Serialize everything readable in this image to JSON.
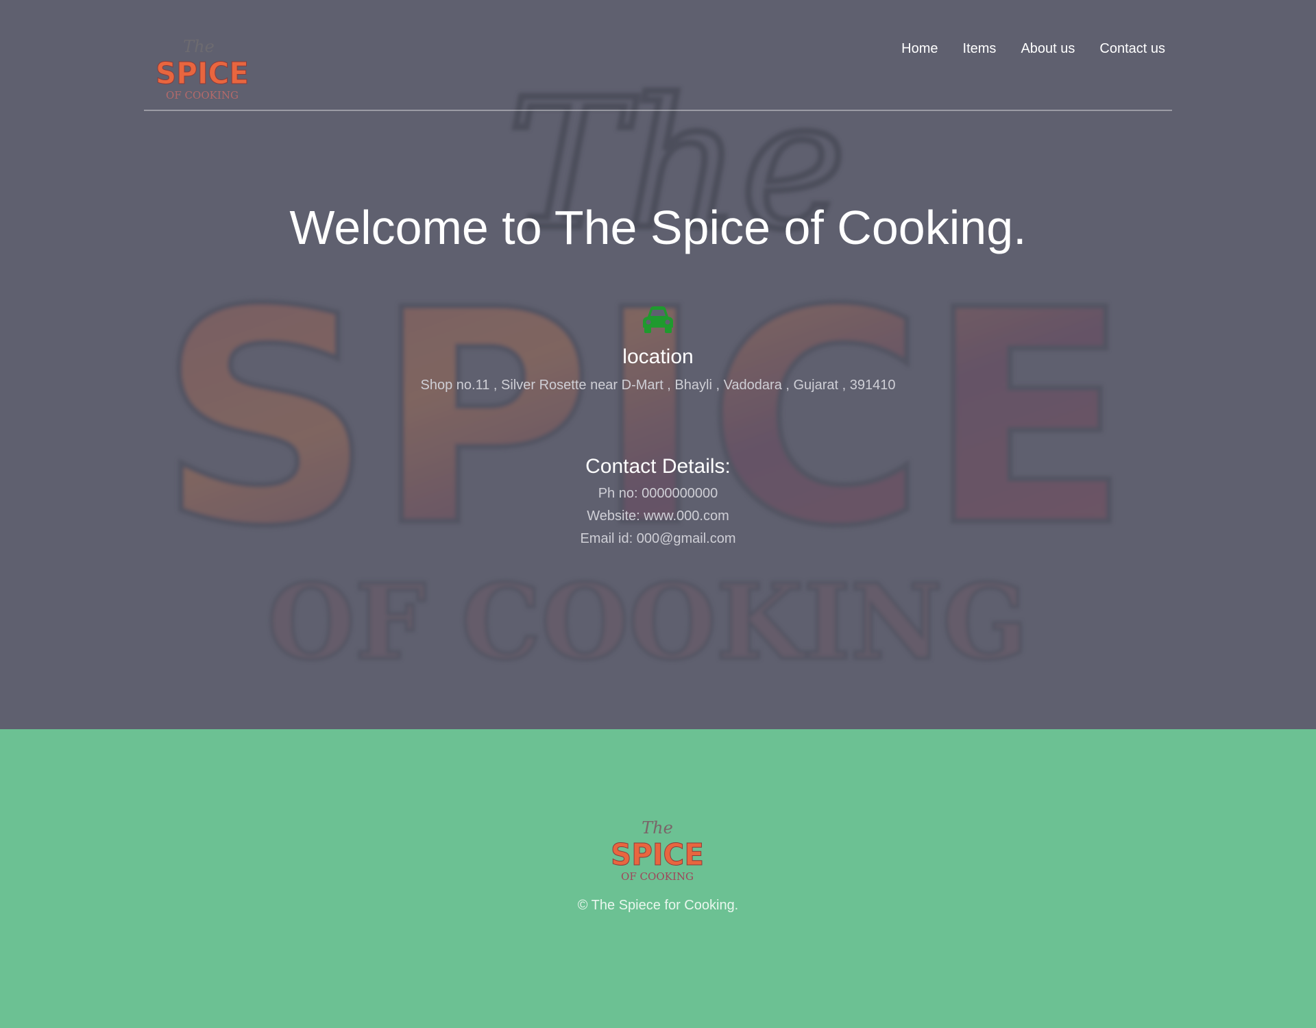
{
  "brand": {
    "logo_script": "The",
    "logo_main": "SPICE",
    "logo_sub": "OF COOKING"
  },
  "nav": {
    "items": [
      {
        "label": "Home"
      },
      {
        "label": "Items"
      },
      {
        "label": "About us"
      },
      {
        "label": "Contact us"
      }
    ]
  },
  "hero": {
    "welcome": "Welcome to The Spice of Cooking.",
    "location_icon": "car-icon",
    "location_title": "location",
    "location_address": "Shop no.11 , Silver Rosette near D-Mart , Bhayli , Vadodara , Gujarat , 391410",
    "contact_heading": "Contact Details:",
    "phone": "Ph no: 0000000000",
    "website": "Website: www.000.com",
    "email": "Email id: 000@gmail.com"
  },
  "footer": {
    "copyright": "© The Spiece for Cooking."
  },
  "colors": {
    "hero_overlay": "#5f606f",
    "footer_bg": "#6cc193",
    "icon_green": "#1f9a2e",
    "logo_orange": "#e8663f"
  }
}
